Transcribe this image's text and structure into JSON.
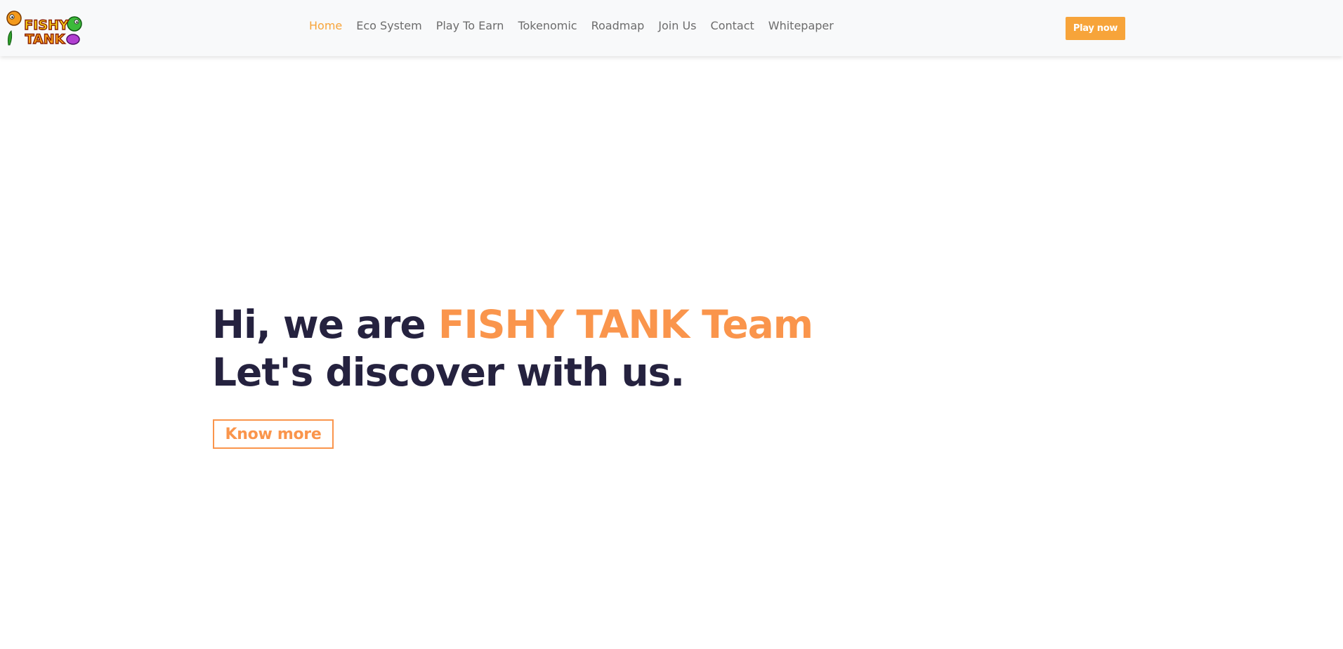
{
  "brand": {
    "logo_text_line1": "FISHY",
    "logo_text_line2": "TANK",
    "logo_icon": "fishy-tank-logo",
    "accent_color": "#f7a43a"
  },
  "nav": {
    "items": [
      {
        "label": "Home",
        "active": true
      },
      {
        "label": "Eco System",
        "active": false
      },
      {
        "label": "Play To Earn",
        "active": false
      },
      {
        "label": "Tokenomic",
        "active": false
      },
      {
        "label": "Roadmap",
        "active": false
      },
      {
        "label": "Join Us",
        "active": false
      },
      {
        "label": "Contact",
        "active": false
      },
      {
        "label": "Whitepaper",
        "active": false
      }
    ],
    "cta_label": "Play now"
  },
  "hero": {
    "line1_prefix": "Hi, we are ",
    "line1_accent": "FISHY TANK Team",
    "line2": "Let's discover with us.",
    "button_label": "Know more",
    "heading_color": "#25223f",
    "accent_color": "#fa954c"
  }
}
